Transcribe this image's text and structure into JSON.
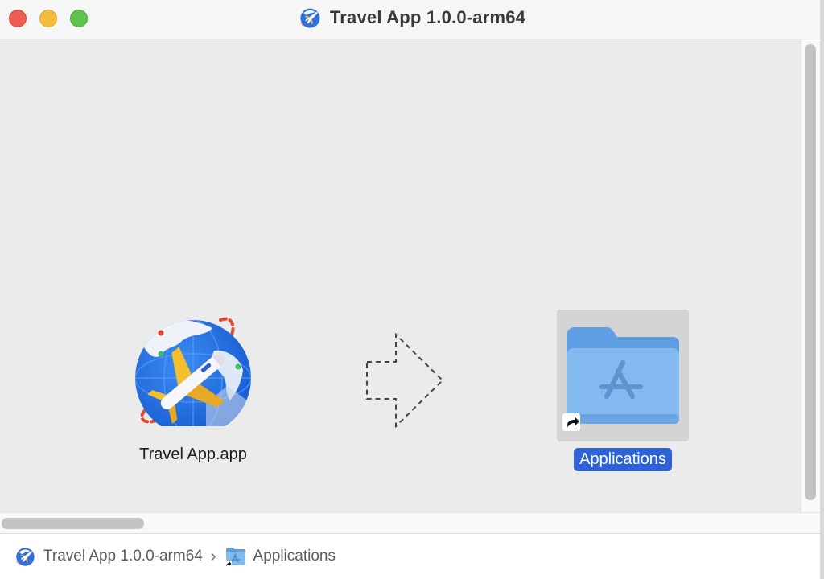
{
  "window": {
    "title": "Travel App 1.0.0-arm64",
    "title_icon": "travel-app-globe-icon"
  },
  "content": {
    "app_item": {
      "label": "Travel App.app",
      "icon": "travel-app-globe-icon"
    },
    "arrow": {
      "icon": "dashed-right-arrow-icon"
    },
    "folder_item": {
      "label": "Applications",
      "icon": "applications-folder-icon",
      "alias_icon": "alias-arrow-icon",
      "selected": true
    }
  },
  "pathbar": {
    "crumbs": [
      {
        "label": "Travel App 1.0.0-arm64",
        "icon": "travel-app-globe-icon"
      },
      {
        "label": "Applications",
        "icon": "applications-folder-icon"
      }
    ],
    "separator": "›"
  },
  "colors": {
    "close": "#ee5b51",
    "minimize": "#f4bc3b",
    "maximize": "#5fc24d",
    "selection": "#2f62d6",
    "folder": "#7fb3ea"
  }
}
